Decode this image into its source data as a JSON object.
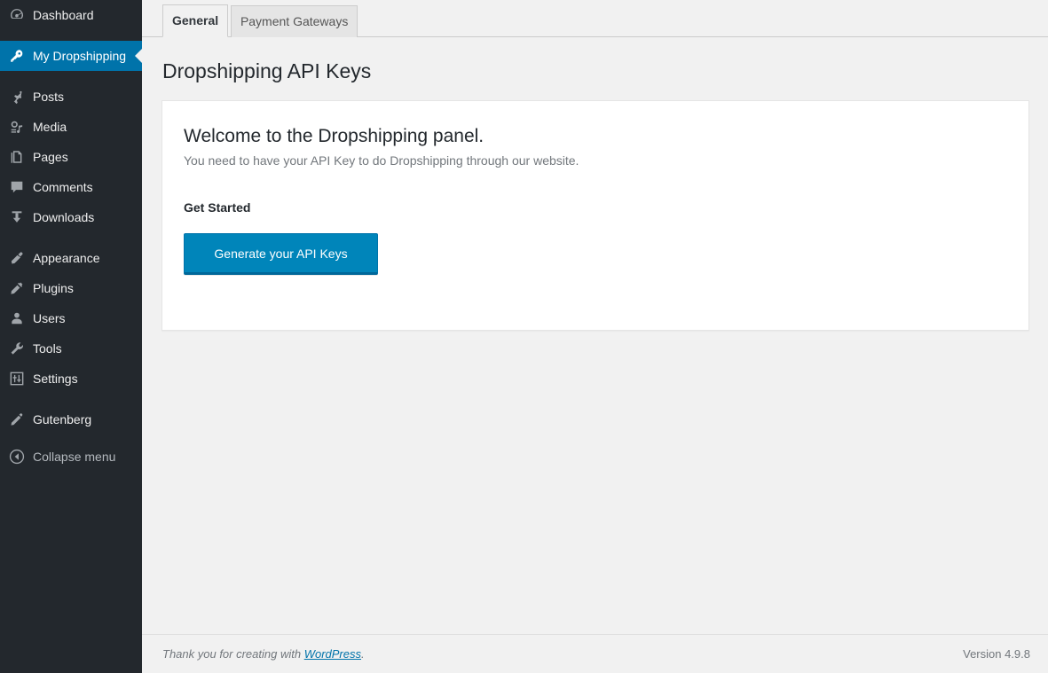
{
  "sidebar": {
    "items": [
      {
        "label": "Dashboard",
        "icon": "dashboard-icon",
        "id": "dashboard",
        "active": false,
        "gap_after": true
      },
      {
        "label": "My Dropshipping",
        "icon": "key-icon",
        "id": "my-dropshipping",
        "active": true,
        "gap_after": true
      },
      {
        "label": "Posts",
        "icon": "pin-icon",
        "id": "posts",
        "active": false,
        "gap_after": false
      },
      {
        "label": "Media",
        "icon": "media-icon",
        "id": "media",
        "active": false,
        "gap_after": false
      },
      {
        "label": "Pages",
        "icon": "pages-icon",
        "id": "pages",
        "active": false,
        "gap_after": false
      },
      {
        "label": "Comments",
        "icon": "comments-icon",
        "id": "comments",
        "active": false,
        "gap_after": false
      },
      {
        "label": "Downloads",
        "icon": "download-icon",
        "id": "downloads",
        "active": false,
        "gap_after": true
      },
      {
        "label": "Appearance",
        "icon": "appearance-icon",
        "id": "appearance",
        "active": false,
        "gap_after": false
      },
      {
        "label": "Plugins",
        "icon": "plugins-icon",
        "id": "plugins",
        "active": false,
        "gap_after": false
      },
      {
        "label": "Users",
        "icon": "users-icon",
        "id": "users",
        "active": false,
        "gap_after": false
      },
      {
        "label": "Tools",
        "icon": "tools-icon",
        "id": "tools",
        "active": false,
        "gap_after": false
      },
      {
        "label": "Settings",
        "icon": "settings-icon",
        "id": "settings",
        "active": false,
        "gap_after": true
      },
      {
        "label": "Gutenberg",
        "icon": "pencil-icon",
        "id": "gutenberg",
        "active": false,
        "gap_after": false
      }
    ],
    "collapse": {
      "label": "Collapse menu",
      "icon": "collapse-arrow-icon"
    }
  },
  "tabs": [
    {
      "label": "General",
      "active": true
    },
    {
      "label": "Payment Gateways",
      "active": false
    }
  ],
  "page_title": "Dropshipping API Keys",
  "panel": {
    "welcome_heading": "Welcome to the Dropshipping panel.",
    "welcome_subtext": "You need to have your API Key to do Dropshipping through our website.",
    "get_started_heading": "Get Started",
    "generate_button_label": "Generate your API Keys"
  },
  "footer": {
    "thanks_prefix": "Thank you for creating with ",
    "wordpress_link": "WordPress",
    "thanks_suffix": ".",
    "version": "Version 4.9.8"
  },
  "colors": {
    "sidebar_bg": "#23282d",
    "active_item_bg": "#0073aa",
    "button_bg": "#0085ba",
    "page_bg": "#f1f1f1",
    "card_bg": "#ffffff",
    "link": "#0073aa",
    "muted_text": "#72777c"
  }
}
